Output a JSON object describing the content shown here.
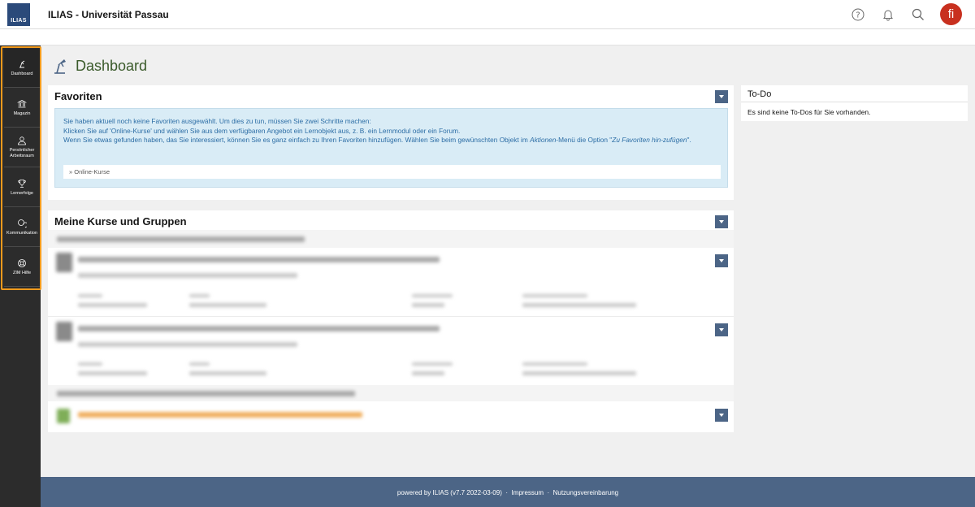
{
  "header": {
    "logo_text": "ILIAS",
    "site_title": "ILIAS - Universität Passau",
    "avatar_initial": "fi"
  },
  "sidebar": {
    "items": [
      {
        "label": "Dashboard",
        "icon": "dashboard-icon"
      },
      {
        "label": "Magazin",
        "icon": "library-icon"
      },
      {
        "label": "Persönlicher Arbeitsraum",
        "icon": "user-icon"
      },
      {
        "label": "Lernerfolge",
        "icon": "trophy-icon"
      },
      {
        "label": "Kommunikation",
        "icon": "chat-icon"
      },
      {
        "label": "ZIM Hilfe",
        "icon": "help-ring-icon"
      }
    ]
  },
  "page": {
    "title": "Dashboard"
  },
  "favorites": {
    "title": "Favoriten",
    "line1": "Sie haben aktuell noch keine Favoriten ausgewählt. Um dies zu tun, müssen Sie zwei Schritte machen:",
    "line2": "Klicken Sie auf 'Online-Kurse' und wählen Sie aus dem verfügbaren Angebot ein Lernobjekt aus, z. B. ein Lernmodul oder ein Forum.",
    "line3_pre": "Wenn Sie etwas gefunden haben, das Sie interessiert, können Sie es ganz einfach zu Ihren Favoriten hinzufügen. Wählen Sie beim gewünschten Objekt im ",
    "line3_em": "Aktionen",
    "line3_mid": "-Menü die Option \"",
    "line3_em2": "Zu Favoriten hin-zufügen",
    "line3_post": "\".",
    "link": "» Online-Kurse"
  },
  "courses": {
    "title": "Meine Kurse und Gruppen"
  },
  "todo": {
    "title": "To-Do",
    "empty": "Es sind keine To-Dos für Sie vorhanden."
  },
  "footer": {
    "powered": "powered by ILIAS (v7.7 2022-03-09)",
    "sep": "·",
    "impressum": "Impressum",
    "nutzung": "Nutzungsvereinbarung"
  }
}
